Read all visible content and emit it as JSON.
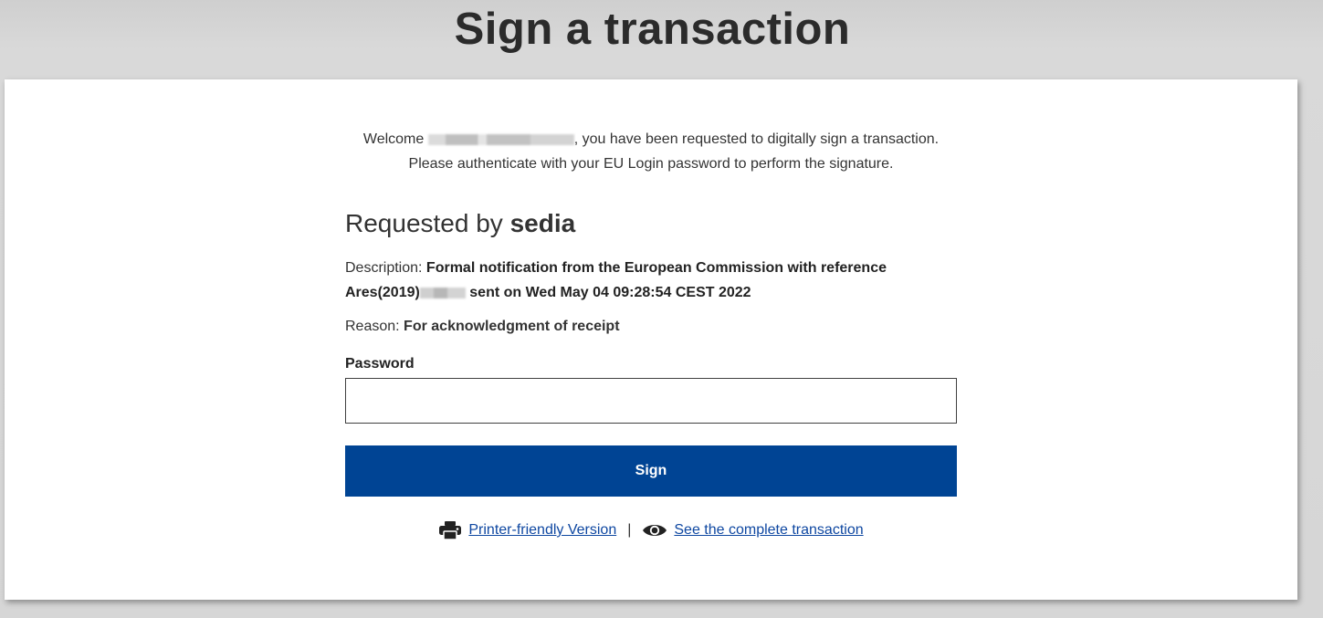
{
  "page": {
    "title": "Sign a transaction"
  },
  "welcome": {
    "prefix": "Welcome",
    "suffix": ", you have been requested to digitally sign a transaction.",
    "line2": "Please authenticate with your EU Login password to perform the signature."
  },
  "requested": {
    "prefix": "Requested by ",
    "requester": "sedia"
  },
  "description": {
    "label": "Description: ",
    "text_before": "Formal notification from the European Commission with reference Ares(2019)",
    "text_after": " sent on Wed May 04 09:28:54 CEST 2022"
  },
  "reason": {
    "label": "Reason: ",
    "text": "For acknowledgment of receipt"
  },
  "password": {
    "label": "Password",
    "value": ""
  },
  "sign_button": {
    "label": "Sign"
  },
  "links": {
    "printer_label": "Printer-friendly Version",
    "separator": "|",
    "complete_label": "See the complete transaction"
  },
  "colors": {
    "primary": "#004494",
    "link": "#0e47a1"
  },
  "icons": {
    "printer": "printer-icon",
    "eye": "eye-icon"
  }
}
